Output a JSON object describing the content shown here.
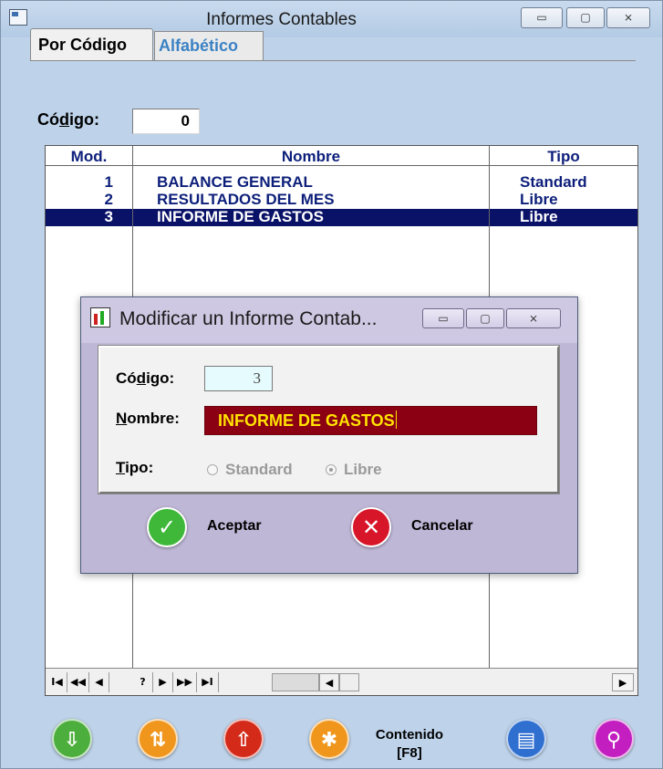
{
  "window": {
    "title": "Informes Contables",
    "buttons": {
      "minimize": "▭",
      "maximize": "▢",
      "close": "⨯"
    }
  },
  "tabs": [
    {
      "label": "Por Código",
      "active": true
    },
    {
      "label": "Alfabético",
      "active": false
    }
  ],
  "codigo": {
    "label_pre": "Có",
    "label_ul": "d",
    "label_post": "igo:",
    "value": "0"
  },
  "grid": {
    "columns": [
      "Mod.",
      "Nombre",
      "Tipo"
    ],
    "rows": [
      {
        "mod": "1",
        "nombre": "BALANCE GENERAL",
        "tipo": "Standard",
        "selected": false
      },
      {
        "mod": "2",
        "nombre": "RESULTADOS DEL MES",
        "tipo": "Libre",
        "selected": false
      },
      {
        "mod": "3",
        "nombre": "INFORME DE GASTOS",
        "tipo": "Libre",
        "selected": true
      }
    ],
    "nav": [
      "I◀",
      "◀◀",
      "◀",
      "?",
      "▶",
      "▶▶",
      "▶I"
    ],
    "scroll": {
      "left": "◀",
      "right": "▶"
    }
  },
  "toolbar": {
    "contenido_label": "Contenido",
    "contenido_key": "[F8]",
    "icons": [
      "arrow-down-icon",
      "arrows-updown-icon",
      "arrow-up-icon",
      "asterisk-icon",
      "document-icon",
      "exit-walk-icon"
    ],
    "colors": [
      "#4cae3c",
      "#f0961c",
      "#d42a1a",
      "#f0961c",
      "#2f6fd0",
      "#c21ec0"
    ]
  },
  "dialog": {
    "title": "Modificar un Informe Contab...",
    "codigo_label": {
      "pre": "Có",
      "ul": "d",
      "post": "igo:"
    },
    "codigo_value": "3",
    "nombre_label": {
      "ul": "N",
      "post": "ombre:"
    },
    "nombre_value": "INFORME DE GASTOS",
    "tipo_label": {
      "ul": "T",
      "post": "ipo:"
    },
    "tipo_options": [
      {
        "label": "Standard",
        "selected": false
      },
      {
        "label": "Libre",
        "selected": true
      }
    ],
    "accept_label": "Aceptar",
    "cancel_label": "Cancelar"
  }
}
